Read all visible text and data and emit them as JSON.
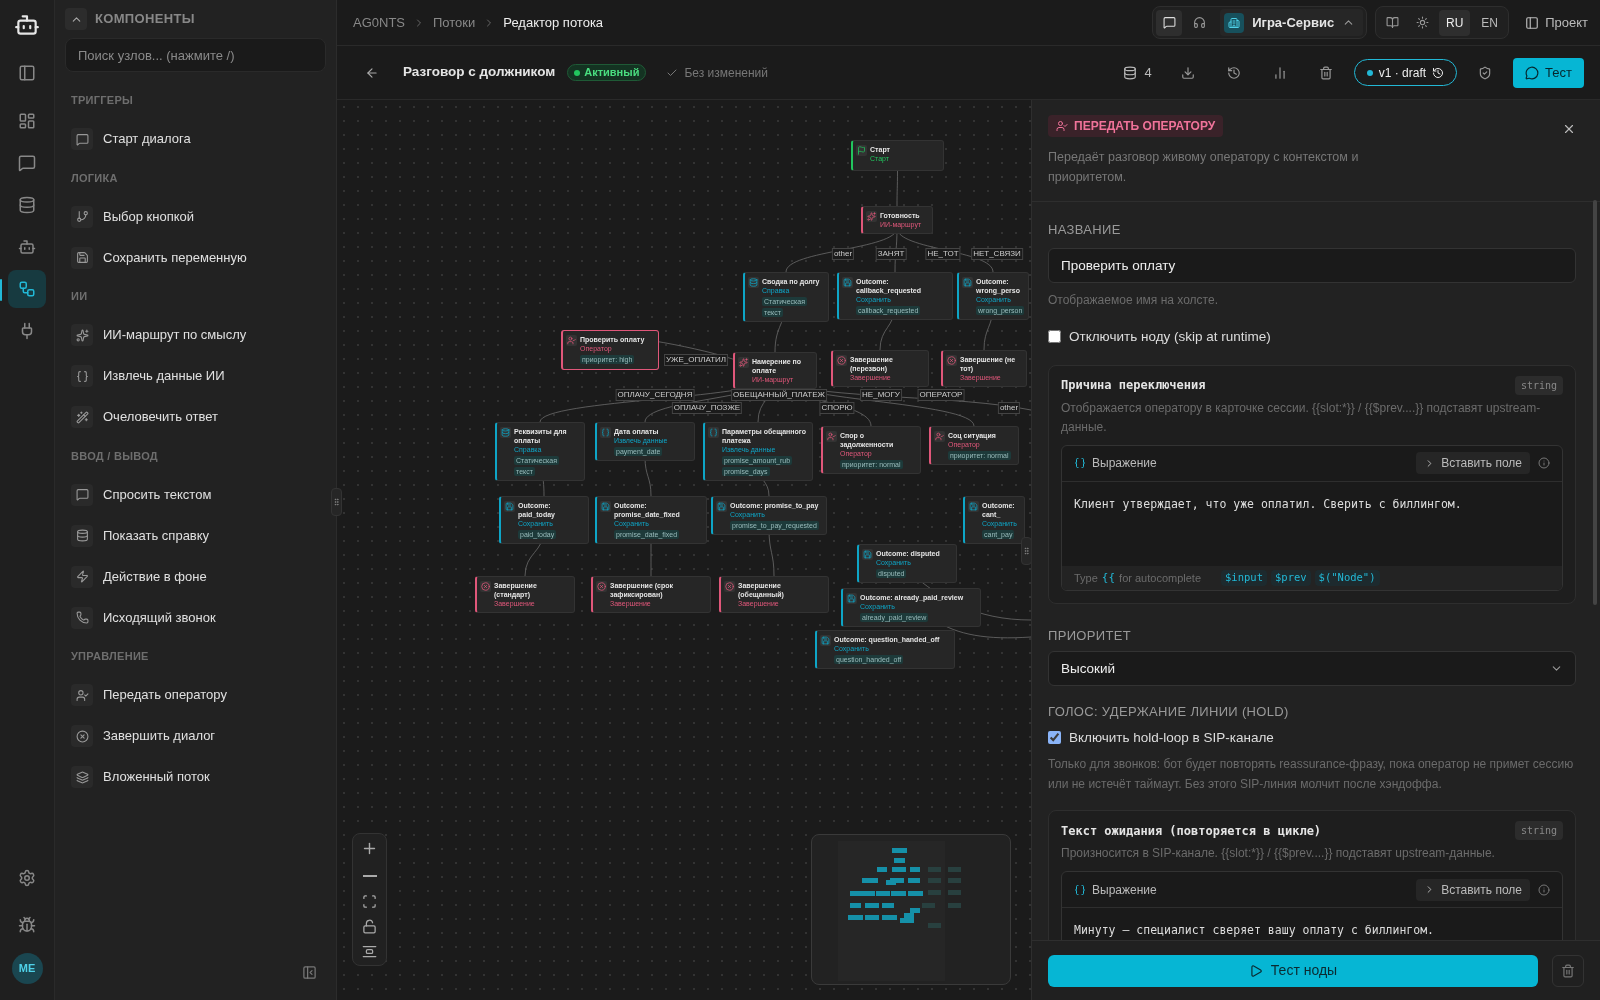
{
  "rail": {
    "items": [
      {
        "kind": "panel",
        "selected": false
      },
      {
        "kind": "dashboard",
        "selected": false
      },
      {
        "kind": "chat",
        "selected": false
      },
      {
        "kind": "database",
        "selected": false
      },
      {
        "kind": "bot",
        "selected": false
      },
      {
        "kind": "flow",
        "selected": true
      },
      {
        "kind": "plug",
        "selected": false
      }
    ],
    "bottom": [
      {
        "kind": "settings"
      },
      {
        "kind": "bug"
      }
    ],
    "avatar": "ME"
  },
  "sidebar": {
    "title": "КОМПОНЕНТЫ",
    "search_placeholder": "Поиск узлов... (нажмите /)",
    "groups": [
      {
        "title": "ТРИГГЕРЫ",
        "items": [
          {
            "label": "Старт диалога",
            "kind": "chat"
          }
        ]
      },
      {
        "title": "ЛОГИКА",
        "items": [
          {
            "label": "Выбор кнопкой",
            "kind": "branch"
          },
          {
            "label": "Сохранить переменную",
            "kind": "save"
          }
        ]
      },
      {
        "title": "ИИ",
        "items": [
          {
            "label": "ИИ-маршрут по смыслу",
            "kind": "sparkles"
          },
          {
            "label": "Извлечь данные ИИ",
            "kind": "braces"
          },
          {
            "label": "Очеловечить ответ",
            "kind": "wand"
          }
        ]
      },
      {
        "title": "ВВОД / ВЫВОД",
        "items": [
          {
            "label": "Спросить текстом",
            "kind": "chat"
          },
          {
            "label": "Показать справку",
            "kind": "database"
          },
          {
            "label": "Действие в фоне",
            "kind": "zap"
          },
          {
            "label": "Исходящий звонок",
            "kind": "phone"
          }
        ]
      },
      {
        "title": "УПРАВЛЕНИЕ",
        "items": [
          {
            "label": "Передать оператору",
            "kind": "operator"
          },
          {
            "label": "Завершить диалог",
            "kind": "end"
          },
          {
            "label": "Вложенный поток",
            "kind": "layers"
          }
        ]
      }
    ]
  },
  "breadcrumbs": [
    "AG0NTS",
    "Потоки",
    "Редактор потока"
  ],
  "workspace": "Игра-Сервис",
  "languages": [
    {
      "label": "RU",
      "selected": true
    },
    {
      "label": "EN",
      "selected": false
    }
  ],
  "project_button": "Проект",
  "flow": {
    "title": "Разговор с должником",
    "status": "Активный",
    "save_state": "Без изменений",
    "count": "4",
    "version": "v1 · draft",
    "test_button": "Тест"
  },
  "canvas": {
    "nodes": [
      {
        "title": "Старт",
        "type": "Старт",
        "kind": "start",
        "selected": false
      },
      {
        "title": "Готовность",
        "type": "ИИ-маршрут",
        "kind": "ai",
        "selected": false
      },
      {
        "title": "Сводка по долгу",
        "type": "Справка",
        "kind": "info",
        "tags": [
          "Статическая",
          "текст"
        ],
        "selected": false
      },
      {
        "title": "Outcome: callback_requested",
        "type": "Сохранить",
        "kind": "save",
        "tags": [
          "callback_requested"
        ],
        "selected": false
      },
      {
        "title": "Outcome: wrong_perso",
        "type": "Сохранить",
        "kind": "save",
        "tags": [
          "wrong_person"
        ],
        "selected": false
      },
      {
        "title": "Проверить оплату",
        "type": "Оператор",
        "kind": "operator",
        "tags": [
          "приоритет: high"
        ],
        "selected": true
      },
      {
        "title": "Намерение по оплате",
        "type": "ИИ-маршрут",
        "kind": "ai",
        "selected": false
      },
      {
        "title": "Завершение (перезвон)",
        "type": "Завершение",
        "kind": "end",
        "selected": false
      },
      {
        "title": "Завершение (не тот)",
        "type": "Завершение",
        "kind": "end",
        "selected": false
      },
      {
        "title": "Реквизиты для оплаты",
        "type": "Справка",
        "kind": "info",
        "tags": [
          "Статическая",
          "текст"
        ],
        "selected": false
      },
      {
        "title": "Дата оплаты",
        "type": "Извлечь данные",
        "kind": "extract",
        "tags": [
          "payment_date"
        ],
        "selected": false
      },
      {
        "title": "Параметры обещанного платежа",
        "type": "Извлечь данные",
        "kind": "extract",
        "tags": [
          "promise_amount_rub",
          "promise_days"
        ],
        "selected": false
      },
      {
        "title": "Спор о задолженности",
        "type": "Оператор",
        "kind": "operator",
        "tags": [
          "приоритет: normal"
        ],
        "selected": false
      },
      {
        "title": "Соц ситуация",
        "type": "Оператор",
        "kind": "operator",
        "tags": [
          "приоритет: normal"
        ],
        "selected": false
      },
      {
        "title": "Outcome: paid_today",
        "type": "Сохранить",
        "kind": "save",
        "tags": [
          "paid_today"
        ],
        "selected": false
      },
      {
        "title": "Outcome: promise_date_fixed",
        "type": "Сохранить",
        "kind": "save",
        "tags": [
          "promise_date_fixed"
        ],
        "selected": false
      },
      {
        "title": "Outcome: promise_to_pay",
        "type": "Сохранить",
        "kind": "save",
        "tags": [
          "promise_to_pay_requested"
        ],
        "selected": false
      },
      {
        "title": "Завершение (стандарт)",
        "type": "Завершение",
        "kind": "end",
        "selected": false
      },
      {
        "title": "Завершение (срок зафиксирован)",
        "type": "Завершение",
        "kind": "end",
        "selected": false
      },
      {
        "title": "Завершение (обещанный)",
        "type": "Завершение",
        "kind": "end",
        "selected": false
      },
      {
        "title": "Outcome: cant_",
        "type": "Сохранить",
        "kind": "save",
        "tags": [
          "cant_pay"
        ],
        "selected": false
      },
      {
        "title": "Outcome: disputed",
        "type": "Сохранить",
        "kind": "save",
        "tags": [
          "disputed"
        ],
        "selected": false
      },
      {
        "title": "Outcome: already_paid_review",
        "type": "Сохранить",
        "kind": "save",
        "tags": [
          "already_paid_review"
        ],
        "selected": false
      },
      {
        "title": "Outcome: question_handed_off",
        "type": "Сохранить",
        "kind": "save",
        "tags": [
          "question_handed_off"
        ],
        "selected": false
      }
    ],
    "edge_labels": [
      "other",
      "ЗАНЯТ",
      "НЕ_ТОТ",
      "НЕТ_СВЯЗИ",
      "УЖЕ_ОПЛАТИЛ",
      "ОПЛАЧУ_СЕГОДНЯ",
      "ОПЛАЧУ_ПОЗЖЕ",
      "ОБЕЩАННЫЙ_ПЛАТЕЖ",
      "СПОРЮ",
      "НЕ_МОГУ",
      "ОПЕРАТОР",
      "other"
    ]
  },
  "inspector": {
    "badge": "ПЕРЕДАТЬ ОПЕРАТОРУ",
    "description": "Передаёт разговор живому оператору с контекстом и приоритетом.",
    "name_label": "НАЗВАНИЕ",
    "name_value": "Проверить оплату",
    "name_hint": "Отображаемое имя на холсте.",
    "disable": {
      "label": "Отключить ноду (skip at runtime)",
      "checked": false
    },
    "reason": {
      "title": "Причина переключения",
      "type": "string",
      "hint": "Отображается оператору в карточке сессии. {{slot:*}} / {{$prev....}} подставят upstream-данные.",
      "mode": "Выражение",
      "insert": "Вставить поле",
      "value": "Клиент утверждает, что уже оплатил. Сверить с биллингом.",
      "footer": {
        "type": "Type",
        "braces": "{{",
        "text": "for autocomplete",
        "vars": [
          "$input",
          "$prev",
          "$(\"Node\")"
        ]
      }
    },
    "priority_label": "ПРИОРИТЕТ",
    "priority_value": "Высокий",
    "voice_label": "ГОЛОС: УДЕРЖАНИЕ ЛИНИИ (HOLD)",
    "hold": {
      "label": "Включить hold-loop в SIP-канале",
      "checked": true
    },
    "hold_hint": "Только для звонков: бот будет повторять reassurance-фразу, пока оператор не примет сессию или не истечёт таймаут. Без этого SIP-линия молчит после хэндоффа.",
    "wait": {
      "title": "Текст ожидания (повторяется в цикле)",
      "type": "string",
      "hint": "Произносится в SIP-канале. {{slot:*}} / {{$prev....}} подставят upstream-данные.",
      "mode": "Выражение",
      "insert": "Вставить поле",
      "value": "Минуту — специалист сверяет вашу оплату с биллингом."
    },
    "test_button": "Тест ноды"
  }
}
